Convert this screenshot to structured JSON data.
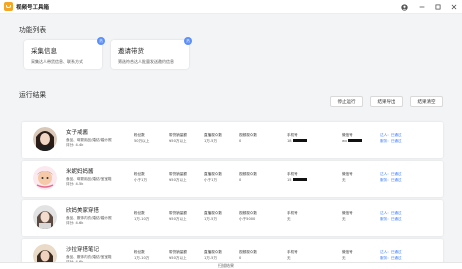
{
  "app": {
    "title": "视频号工具箱"
  },
  "window": {
    "user_icon": "user-icon",
    "min_icon": "minimize-icon",
    "max_icon": "maximize-icon",
    "close_icon": "close-icon"
  },
  "functions": {
    "title": "功能列表",
    "cards": [
      {
        "title": "采集信息",
        "desc": "采集达人带货信息、联系方式",
        "badge": "热"
      },
      {
        "title": "邀请带货",
        "desc": "筛选符合达人批量发送邀约信息",
        "badge": "热"
      }
    ]
  },
  "results": {
    "title": "运行结果",
    "buttons": {
      "stop": "停止运行",
      "export": "结果导出",
      "clear": "结果清空"
    },
    "rows": [
      {
        "name": "女子戒酱",
        "sub1": "食品、母婴用品/婚纺/婚纱照",
        "sub2": "评分: 4.4k",
        "fans_label": "粉丝数",
        "fans": "50万以上",
        "sales_label": "带货销量额",
        "sales": "¥50万以上",
        "live_label": "直播观众数",
        "live": "1万-5万",
        "video_label": "视频观众数",
        "video": "0",
        "phone_label": "手机号",
        "phone": "18",
        "wechat_label": "微信号",
        "wechat": "wx",
        "link1": "达人：已通过",
        "link2": "服务：已通过"
      },
      {
        "name": "米妮妈妈酱",
        "sub1": "食品、母婴用品/婚纺/宝宝鞋",
        "sub2": "评分: 4.5k",
        "fans_label": "粉丝数",
        "fans": "小于1万",
        "sales_label": "带货销量额",
        "sales": "¥50万以上",
        "live_label": "直播观众数",
        "live": "小于1万",
        "video_label": "视频观众数",
        "video": "0",
        "phone_label": "手机号",
        "phone": "15",
        "wechat_label": "微信号",
        "wechat": "无",
        "link1": "达人：已通过",
        "link2": "服务：已通过"
      },
      {
        "name": "欣妈美家穿搭",
        "sub1": "食品、服饰内衣/婚纺/婚纱照",
        "sub2": "评分: 4.6k",
        "fans_label": "粉丝数",
        "fans": "1万-10万",
        "sales_label": "带货销量额",
        "sales": "¥50万以上",
        "live_label": "直播观众数",
        "live": "1万-5万",
        "video_label": "视频观众数",
        "video": "小于5000",
        "phone_label": "手机号",
        "phone": "无",
        "wechat_label": "微信号",
        "wechat": "无",
        "link1": "达人：已通过",
        "link2": "服务：已通过"
      },
      {
        "name": "沙拉穿搭笔记",
        "sub1": "食品、服饰内衣/婚纺/宝宝鞋",
        "sub2": "评分: 4.6k",
        "fans_label": "粉丝数",
        "fans": "1万-10万",
        "sales_label": "带货销量额",
        "sales": "¥50万以上",
        "live_label": "直播观众数",
        "live": "1万-5万",
        "video_label": "视频观众数",
        "video": "0",
        "phone_label": "手机号",
        "phone": "无",
        "wechat_label": "微信号",
        "wechat": "无",
        "link1": "达人：已通过",
        "link2": "服务：已通过"
      }
    ]
  },
  "footer": {
    "label": "扫描结果"
  },
  "colors": {
    "accent": "#3a7bff",
    "badge": "#5b8ff9",
    "app_icon": "#f5a623"
  }
}
